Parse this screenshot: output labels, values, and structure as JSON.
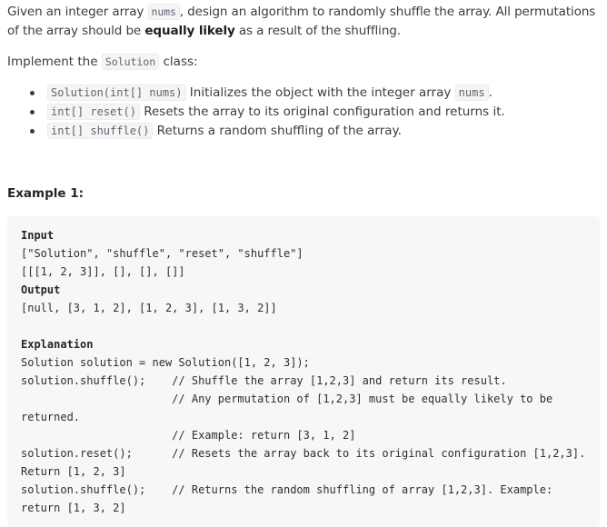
{
  "intro": {
    "part1": "Given an integer array ",
    "nums_code": "nums",
    "part2": ", design an algorithm to randomly shuffle the array. All permutations of the array should be ",
    "bold": "equally likely",
    "part3": " as a result of the shuffling."
  },
  "impl": {
    "prefix": "Implement the ",
    "class_code": "Solution",
    "suffix": " class:"
  },
  "methods": [
    {
      "code": "Solution(int[] nums)",
      "text": " Initializes the object with the integer array ",
      "code2": "nums",
      "text2": "."
    },
    {
      "code": "int[] reset()",
      "text": " Resets the array to its original configuration and returns it."
    },
    {
      "code": "int[] shuffle()",
      "text": " Returns a random shuffling of the array."
    }
  ],
  "example": {
    "title": "Example 1:",
    "input_label": "Input",
    "input_line1": "[\"Solution\", \"shuffle\", \"reset\", \"shuffle\"]",
    "input_line2": "[[[1, 2, 3]], [], [], []]",
    "output_label": "Output",
    "output_line": "[null, [3, 1, 2], [1, 2, 3], [1, 3, 2]]",
    "explanation_label": "Explanation",
    "lines": [
      "Solution solution = new Solution([1, 2, 3]);",
      "solution.shuffle();    // Shuffle the array [1,2,3] and return its result.",
      "                       // Any permutation of [1,2,3] must be equally likely to be",
      "returned.",
      "                       // Example: return [3, 1, 2]",
      "solution.reset();      // Resets the array back to its original configuration [1,2,3].",
      "Return [1, 2, 3]",
      "solution.shuffle();    // Returns the random shuffling of array [1,2,3]. Example:",
      "return [1, 3, 2]"
    ]
  }
}
